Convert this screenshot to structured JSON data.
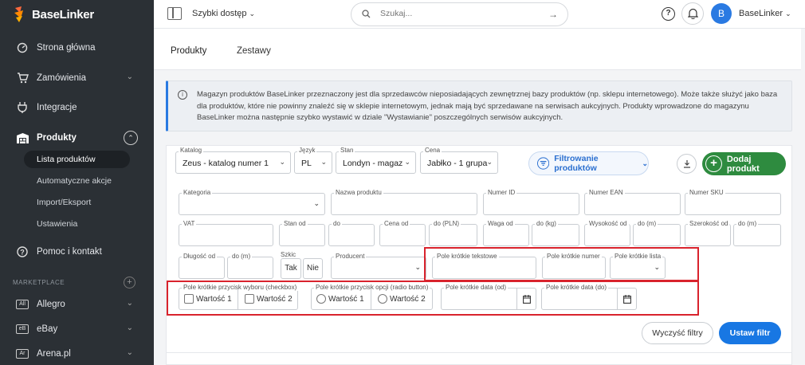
{
  "brand": {
    "name": "BaseLinker"
  },
  "sidebar": {
    "items": [
      {
        "label": "Strona główna",
        "icon": "dashboard-icon"
      },
      {
        "label": "Zamówienia",
        "icon": "cart-icon"
      },
      {
        "label": "Integracje",
        "icon": "plug-icon"
      },
      {
        "label": "Produkty",
        "icon": "warehouse-icon"
      },
      {
        "label": "Pomoc i kontakt",
        "icon": "help-icon"
      }
    ],
    "products_sub": [
      {
        "label": "Lista produktów",
        "active": true
      },
      {
        "label": "Automatyczne akcje"
      },
      {
        "label": "Import/Eksport"
      },
      {
        "label": "Ustawienia"
      }
    ],
    "marketplace_label": "MARKETPLACE",
    "marketplaces": [
      {
        "label": "Allegro",
        "badge": "All"
      },
      {
        "label": "eBay",
        "badge": "eB"
      },
      {
        "label": "Arena.pl",
        "badge": "Ar"
      }
    ]
  },
  "topbar": {
    "quick_access": "Szybki dostęp",
    "search_placeholder": "Szukaj...",
    "user_initial": "B",
    "user_name": "BaseLinker"
  },
  "tabs": [
    {
      "label": "Produkty",
      "active": true
    },
    {
      "label": "Zestawy"
    }
  ],
  "info_text": "Magazyn produktów BaseLinker przeznaczony jest dla sprzedawców nieposiadających zewnętrznej bazy produktów (np. sklepu internetowego). Może także służyć jako baza dla produktów, które nie powinny znaleźć się w sklepie internetowym, jednak mają być sprzedawane na serwisach aukcyjnych. Produkty wprowadzone do magazynu BaseLinker można następnie szybko wystawić w dziale \"Wystawianie\" poszczególnych serwisów aukcyjnych.",
  "toolbar": {
    "catalog_label": "Katalog",
    "catalog_value": "Zeus - katalog numer 1",
    "lang_label": "Język",
    "lang_value": "PL",
    "stock_label": "Stan",
    "stock_value": "Londyn - magaz",
    "price_label": "Cena",
    "price_value": "Jabłko - 1 grupa",
    "filter_button": "Filtrowanie produktów",
    "add_button": "Dodaj produkt"
  },
  "filters": {
    "category": "Kategoria",
    "product_name": "Nazwa produktu",
    "id": "Numer ID",
    "ean": "Numer EAN",
    "sku": "Numer SKU",
    "vat": "VAT",
    "stock_from": "Stan od",
    "stock_to": "do",
    "price_from": "Cena od",
    "price_to": "do (PLN)",
    "weight_from": "Waga od",
    "weight_to": "do (kg)",
    "height_from": "Wysokość od",
    "height_to": "do (m)",
    "width_from": "Szerokość od",
    "width_to": "do (m)",
    "length_from": "Długość od",
    "length_to": "do (m)",
    "sketch": "Szkic",
    "yes": "Tak",
    "no": "Nie",
    "producer": "Producent",
    "short_text": "Pole krótkie tekstowe",
    "short_number": "Pole krótkie numer",
    "short_list": "Pole krótkie lista",
    "checkbox_field": "Pole krótkie przycisk wyboru (checkbox)",
    "radio_field": "Pole krótkie przycisk opcji (radio button)",
    "value1": "Wartość 1",
    "value2": "Wartość 2",
    "date1": "Pole krótkie data (od)",
    "date2": "Pole krótkie data (do)",
    "clear_button": "Wyczyść filtry",
    "apply_button": "Ustaw filtr"
  }
}
